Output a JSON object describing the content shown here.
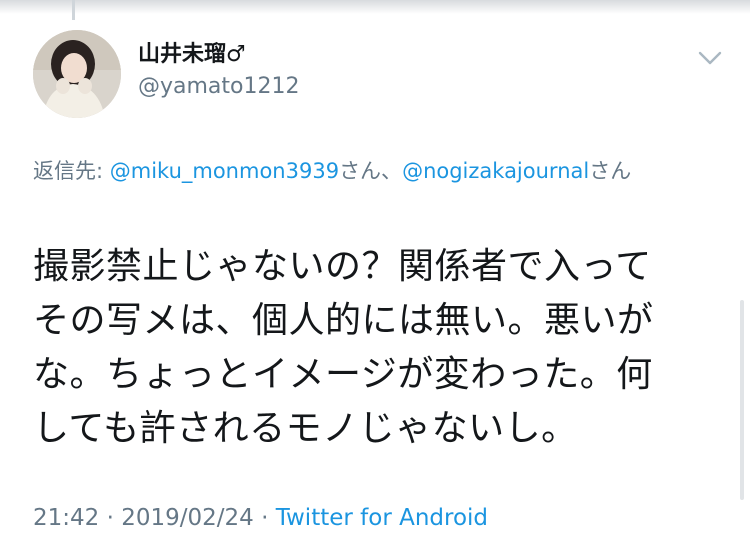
{
  "tweet": {
    "display_name": "山井未瑠♂",
    "username": "@yamato1212",
    "reply_label": "返信先: ",
    "reply_mention_1": "@miku_monmon3939",
    "reply_sep": "さん、",
    "reply_mention_2": "@nogizakajournal",
    "reply_suffix": "さん",
    "text_lines": [
      "撮影禁止じゃないの？関係者で入って",
      "その写メは、個人的には無い。悪いが",
      "な。ちょっとイメージが変わった。何",
      "しても許されるモノじゃないし。"
    ],
    "time": "21:42",
    "separator": " · ",
    "date": "2019/02/24",
    "source": "Twitter for Android"
  },
  "icons": {
    "avatar": "profile-photo",
    "caret": "chevron-down-icon"
  },
  "colors": {
    "link": "#1b95e0",
    "secondary_text": "#657786",
    "primary_text": "#14171a"
  }
}
